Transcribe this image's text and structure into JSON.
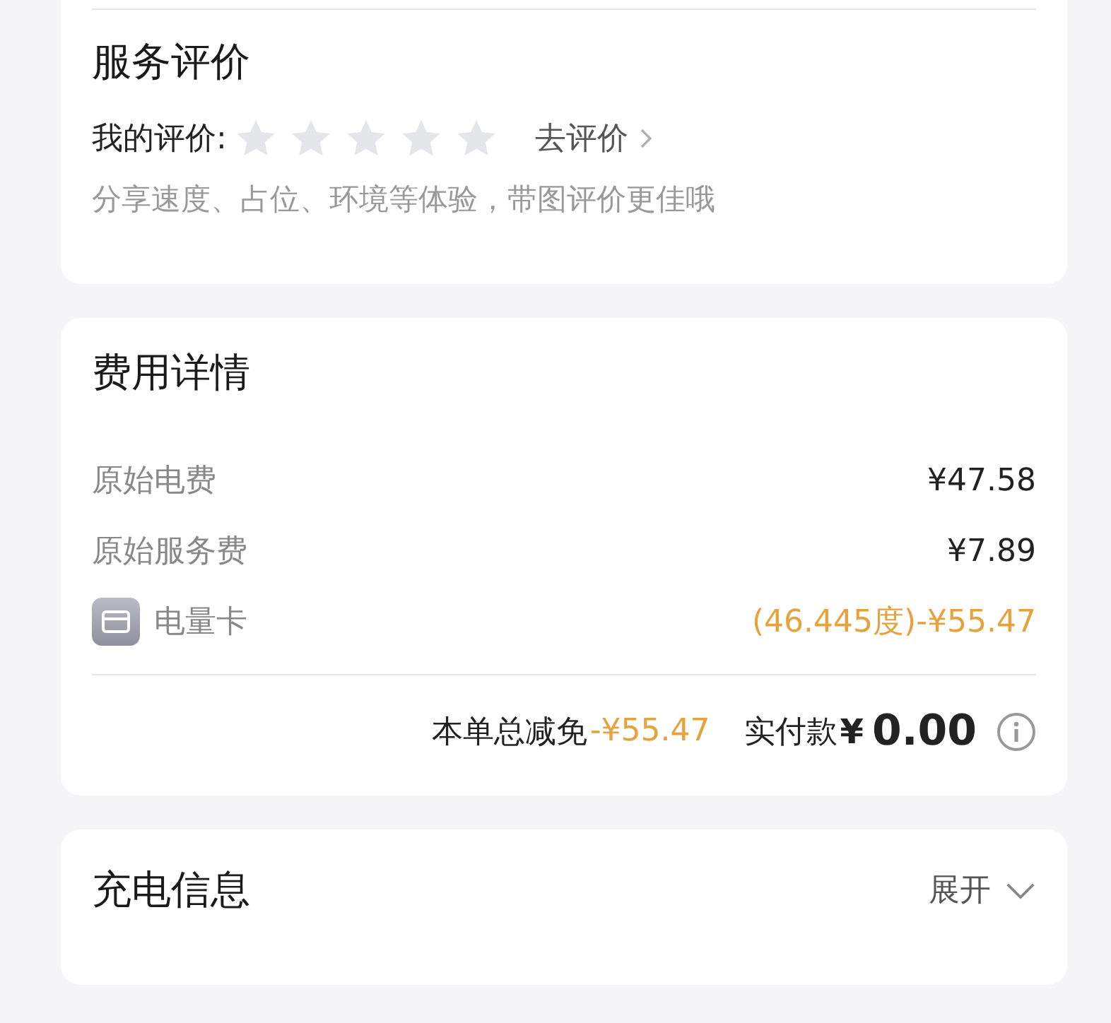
{
  "review": {
    "title": "服务评价",
    "my_label": "我的评价:",
    "stars": 0,
    "action": "去评价",
    "hint": "分享速度、占位、环境等体验，带图评价更佳哦"
  },
  "fees": {
    "title": "费用详情",
    "rows": [
      {
        "kind": "plain",
        "label": "原始电费",
        "value": "¥47.58"
      },
      {
        "kind": "plain",
        "label": "原始服务费",
        "value": "¥7.89"
      },
      {
        "kind": "card",
        "label": "电量卡",
        "value": "(46.445度)-¥55.47"
      }
    ],
    "discount_label": "本单总减免",
    "discount_value": "-¥55.47",
    "paid_label": "实付款",
    "paid_currency": "¥",
    "paid_value": "0.00"
  },
  "charging": {
    "title": "充电信息",
    "toggle": "展开"
  }
}
